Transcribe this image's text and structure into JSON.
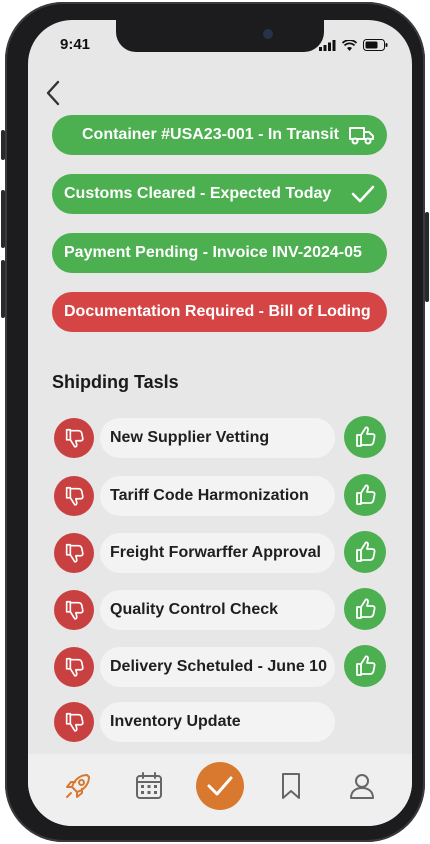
{
  "status_bar": {
    "time": "9:41"
  },
  "alerts": [
    {
      "label": "Container #USA23-001 - In Transit",
      "status": "green",
      "icon": "truck-icon"
    },
    {
      "label": "Customs Cleared - Expected Today",
      "status": "green",
      "icon": "checkmark-icon"
    },
    {
      "label": "Payment Pending - Invoice INV-2024-05",
      "status": "green",
      "icon": ""
    },
    {
      "label": "Documentation Required - Bill of Loding",
      "status": "red",
      "icon": ""
    }
  ],
  "section_title": "Shipding Tasls",
  "tasks": [
    {
      "label": "New Supplier Vetting",
      "has_like": true
    },
    {
      "label": "Tariff Code Harmonization",
      "has_like": true
    },
    {
      "label": "Freight Forwarffer Approval",
      "has_like": true
    },
    {
      "label": "Quality Control Check",
      "has_like": true
    },
    {
      "label": "Delivery Schetuled - June 10",
      "has_like": true
    },
    {
      "label": "Inventory Update",
      "has_like": false
    }
  ],
  "bottom_nav": [
    "rocket-icon",
    "calendar-icon",
    "checkmark-icon",
    "bookmark-icon",
    "person-icon"
  ],
  "colors": {
    "green": "#4caf50",
    "red": "#d64545",
    "accent": "#d9782f",
    "screen_bg": "#e7e7e8"
  }
}
